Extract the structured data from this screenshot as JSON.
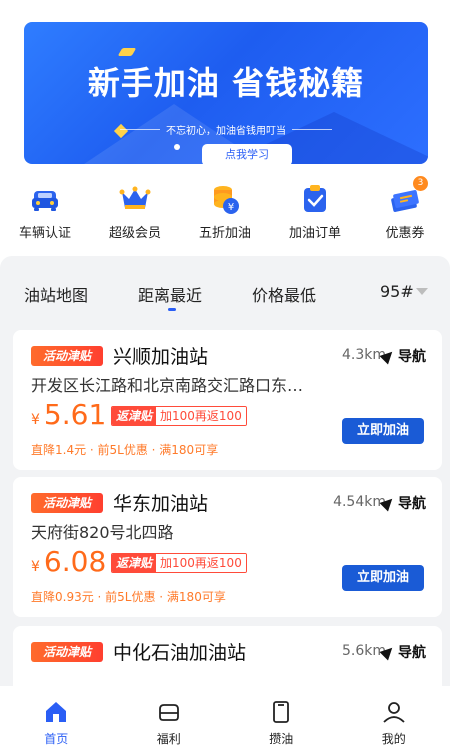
{
  "banner": {
    "title": "新手加油 省钱秘籍",
    "subtitle": "不忘初心，加油省钱用叮当",
    "button": "点我学习"
  },
  "quick_menu": [
    {
      "label": "车辆认证",
      "icon": "car-icon"
    },
    {
      "label": "超级会员",
      "icon": "crown-icon"
    },
    {
      "label": "五折加油",
      "icon": "coin-icon"
    },
    {
      "label": "加油订单",
      "icon": "order-icon"
    },
    {
      "label": "优惠券",
      "icon": "coupon-icon",
      "badge": "3"
    }
  ],
  "tabs": {
    "map": "油站地图",
    "nearest": "距离最近",
    "cheapest": "价格最低",
    "fuel_type": "95#"
  },
  "stations": [
    {
      "tag": "活动津贴",
      "name": "兴顺加油站",
      "distance": "4.3km",
      "nav": "导航",
      "address": "开发区长江路和北京南路交汇路口东…",
      "yen": "¥",
      "price": "5.61",
      "promo_a": "返津贴",
      "promo_b": "加100再返100",
      "button": "立即加油",
      "note": "直降1.4元 · 前5L优惠 · 满180可享"
    },
    {
      "tag": "活动津贴",
      "name": "华东加油站",
      "distance": "4.54km",
      "nav": "导航",
      "address": "天府街820号北四路",
      "yen": "¥",
      "price": "6.08",
      "promo_a": "返津贴",
      "promo_b": "加100再返100",
      "button": "立即加油",
      "note": "直降0.93元 · 前5L优惠 · 满180可享"
    },
    {
      "tag": "活动津贴",
      "name": "中化石油加油站",
      "distance": "5.6km",
      "nav": "导航"
    }
  ],
  "bottom_nav": [
    {
      "label": "首页",
      "icon": "home-icon",
      "active": true
    },
    {
      "label": "福利",
      "icon": "welfare-icon"
    },
    {
      "label": "攒油",
      "icon": "save-fuel-icon"
    },
    {
      "label": "我的",
      "icon": "profile-icon"
    }
  ],
  "colors": {
    "primary": "#2a5ef5",
    "accent": "#ff6a1a",
    "tag": "#ff4b3a"
  }
}
